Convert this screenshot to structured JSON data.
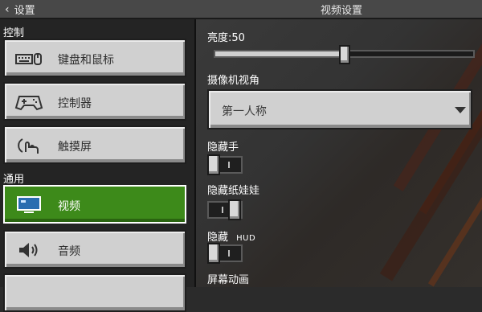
{
  "header": {
    "back_label": "设置",
    "title": "视频设置"
  },
  "sidebar": {
    "sections": [
      {
        "label": "控制"
      },
      {
        "label": "通用"
      }
    ],
    "items": [
      {
        "label": "键盘和鼠标",
        "icon": "keyboard-mouse-icon"
      },
      {
        "label": "控制器",
        "icon": "gamepad-icon"
      },
      {
        "label": "触摸屏",
        "icon": "touch-hand-icon"
      },
      {
        "label": "视频",
        "icon": "monitor-icon",
        "active": true
      },
      {
        "label": "音频",
        "icon": "speaker-icon"
      }
    ]
  },
  "settings": {
    "brightness": {
      "label": "亮度:50",
      "value": 50,
      "max": 100
    },
    "camera": {
      "label": "摄像机视角",
      "selected": "第一人称"
    },
    "hide_hand": {
      "label": "隐藏手",
      "on": false
    },
    "hide_paperdoll": {
      "label": "隐藏纸娃娃",
      "on": true
    },
    "hide_hud": {
      "label": "隐藏",
      "suffix": "HUD",
      "on": false
    },
    "screen_anim": {
      "label": "屏幕动画"
    }
  },
  "colors": {
    "accent": "#3d8a1a",
    "button": "#d0d0d0",
    "background": "#2b2b2b"
  }
}
